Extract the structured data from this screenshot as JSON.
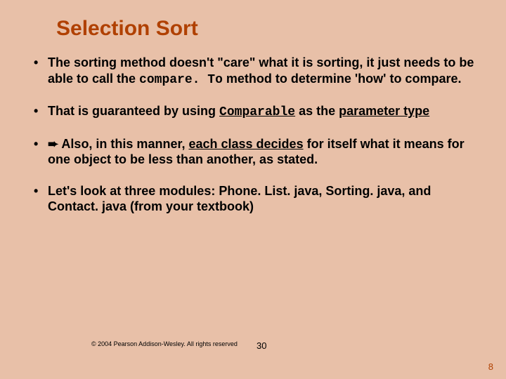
{
  "title": "Selection Sort",
  "bullets": {
    "b1a": "The sorting method doesn't \"care\" what it is sorting, it just needs to be able to call the ",
    "b1_code": "compare. To",
    "b1b": " method to determine 'how' to compare.",
    "b2a": "That is guaranteed by using ",
    "b2_code": "Comparable",
    "b2b": " as the ",
    "b2_u": "parameter type",
    "b3_arrow": "➨",
    "b3a": "  Also, in this manner, ",
    "b3_u": "each class decides",
    "b3b": " for itself what it means for one object to be less than another, as stated.",
    "b4": "Let's look at three modules:  Phone. List. java, Sorting. java, and Contact. java (from your textbook)"
  },
  "copyright": "© 2004 Pearson Addison-Wesley. All rights reserved",
  "slidenum": "30",
  "pagenum": "8"
}
